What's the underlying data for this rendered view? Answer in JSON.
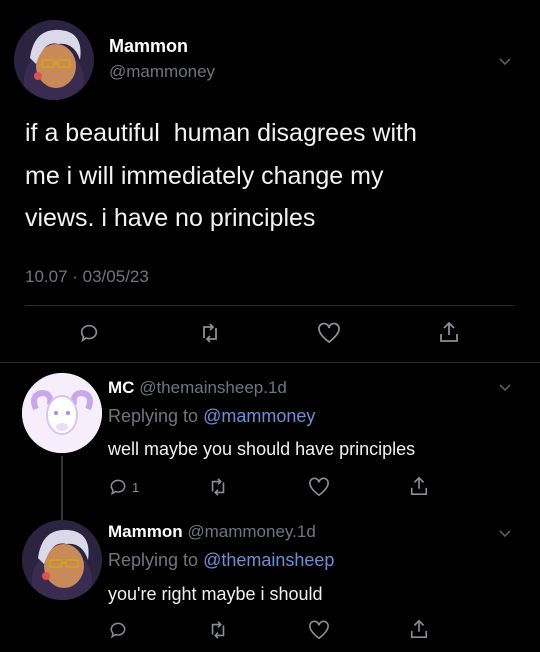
{
  "main_tweet": {
    "display_name": "Mammon",
    "handle": "@mammoney",
    "text_line1": "if a beautiful  human disagrees with",
    "text_line2": "me i will immediately change my",
    "text_line3": "views. i have no principles",
    "timestamp": "10.07 · 03/05/23"
  },
  "reply1": {
    "display_name": "MC",
    "handle": "@themainsheep.1d",
    "replying_prefix": "Replying to",
    "replying_to": "@mammoney",
    "text": "well maybe you should have principles",
    "reply_count": "1"
  },
  "reply2": {
    "display_name": "Mammon",
    "handle": "@mammoney.1d",
    "replying_prefix": "Replying to",
    "replying_to": "@themainsheep",
    "text": "you're right maybe i should"
  },
  "icons": [
    "reply-icon",
    "retweet-icon",
    "like-icon",
    "share-icon",
    "chevron-down-icon"
  ],
  "colors": {
    "background": "#000000",
    "link": "#6f8fd8",
    "muted": "#71767b"
  }
}
